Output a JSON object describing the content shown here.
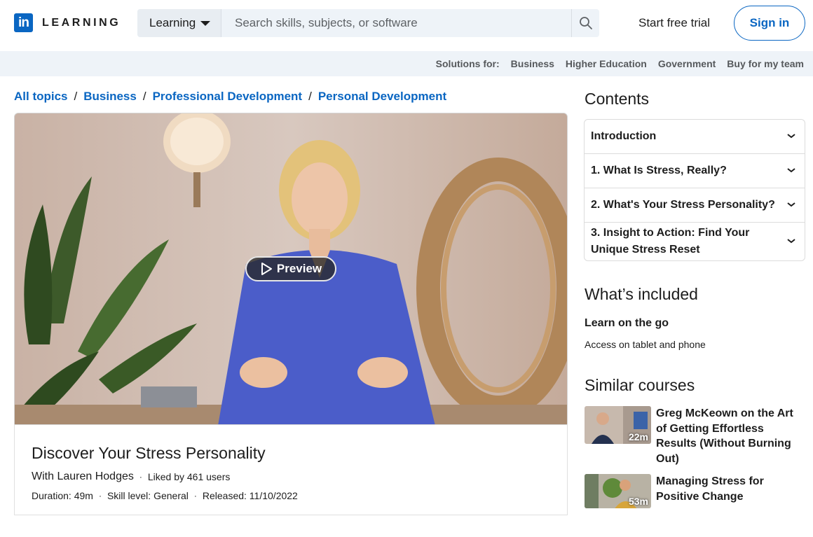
{
  "header": {
    "logo_mark": "in",
    "logo_text": "LEARNING",
    "search_scope": "Learning",
    "search_placeholder": "Search skills, subjects, or software",
    "start_trial": "Start free trial",
    "sign_in": "Sign in"
  },
  "solutions": {
    "label": "Solutions for:",
    "items": [
      "Business",
      "Higher Education",
      "Government",
      "Buy for my team"
    ]
  },
  "breadcrumb": [
    "All topics",
    "Business",
    "Professional Development",
    "Personal Development"
  ],
  "video": {
    "preview_label": "Preview"
  },
  "course": {
    "title": "Discover Your Stress Personality",
    "author": "With Lauren Hodges",
    "likes": "Liked by 461 users",
    "duration": "Duration: 49m",
    "skill": "Skill level: General",
    "released": "Released: 11/10/2022"
  },
  "contents": {
    "heading": "Contents",
    "items": [
      "Introduction",
      "1. What Is Stress, Really?",
      "2. What's Your Stress Personality?",
      "3. Insight to Action: Find Your Unique Stress Reset"
    ]
  },
  "included": {
    "heading": "What’s included",
    "title": "Learn on the go",
    "desc": "Access on tablet and phone"
  },
  "similar": {
    "heading": "Similar courses",
    "items": [
      {
        "title": "Greg McKeown on the Art of Getting Effortless Results (Without Burning Out)",
        "duration": "22m"
      },
      {
        "title": "Managing Stress for Positive Change",
        "duration": "53m"
      }
    ]
  },
  "colors": {
    "brand": "#0a66c2",
    "bar": "#eef3f8"
  }
}
